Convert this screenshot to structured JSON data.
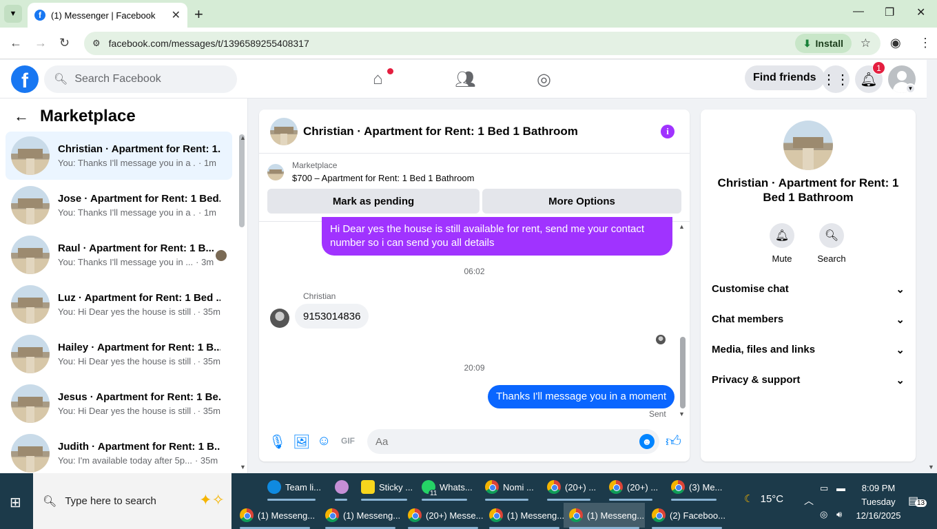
{
  "browser": {
    "tab_title": "(1) Messenger | Facebook",
    "url": "facebook.com/messages/t/1396589255408317",
    "install_label": "Install"
  },
  "fb": {
    "search_placeholder": "Search Facebook",
    "find_friends": "Find friends",
    "notifications_count": "1"
  },
  "left": {
    "title": "Marketplace",
    "conversations": [
      {
        "name": "Christian · Apartment for Rent: 1...",
        "msg": "You: Thanks I'll message you in a ...",
        "time": "· 1m"
      },
      {
        "name": "Jose · Apartment for Rent: 1 Bed...",
        "msg": "You: Thanks I'll message you in a ...",
        "time": "· 1m"
      },
      {
        "name": "Raul · Apartment for Rent: 1 B...",
        "msg": "You: Thanks I'll message you in ...",
        "time": "· 3m"
      },
      {
        "name": "Luz · Apartment for Rent: 1 Bed ...",
        "msg": "You: Hi Dear yes the house is still ...",
        "time": "· 35m"
      },
      {
        "name": "Hailey · Apartment for Rent: 1 B...",
        "msg": "You: Hi Dear yes the house is still ...",
        "time": "· 35m"
      },
      {
        "name": "Jesus · Apartment for Rent: 1 Be...",
        "msg": "You: Hi Dear yes the house is still ...",
        "time": "· 35m"
      },
      {
        "name": "Judith · Apartment for Rent: 1 B...",
        "msg": "You: I'm available today after 5p...",
        "time": "· 35m"
      }
    ]
  },
  "chat": {
    "title": "Christian · Apartment for Rent: 1 Bed 1 Bathroom",
    "listing_category": "Marketplace",
    "listing_title": "$700 – Apartment for Rent: 1 Bed 1 Bathroom",
    "mark_pending": "Mark as pending",
    "more_options": "More Options",
    "msg1": "Hi Dear yes the house is still available for rent, send me your contact number so i can send you all details",
    "time1": "06:02",
    "sender": "Christian",
    "msg2": "9153014836",
    "time2": "20:09",
    "msg3": "Thanks I'll message you in a moment",
    "sent_label": "Sent",
    "composer_placeholder": "Aa",
    "accent": "#a033ff"
  },
  "right": {
    "title": "Christian · Apartment for Rent: 1 Bed 1 Bathroom",
    "mute": "Mute",
    "search": "Search",
    "sections": [
      "Customise chat",
      "Chat members",
      "Media, files and links",
      "Privacy & support"
    ]
  },
  "taskbar": {
    "search_placeholder": "Type here to search",
    "row1": [
      {
        "label": "Team li..."
      },
      {
        "label": ""
      },
      {
        "label": "Sticky ..."
      },
      {
        "label": "Whats..."
      },
      {
        "label": "Nomi ..."
      },
      {
        "label": "(20+) ..."
      },
      {
        "label": "(20+) ..."
      },
      {
        "label": "(3) Me..."
      }
    ],
    "row2": [
      {
        "label": "(1) Messeng..."
      },
      {
        "label": "(1) Messeng..."
      },
      {
        "label": "(20+) Messe..."
      },
      {
        "label": "(1) Messeng..."
      },
      {
        "label": "(1) Messeng..."
      },
      {
        "label": "(2) Faceboo..."
      }
    ],
    "whatsapp_badge": "11",
    "weather": "15°C",
    "time": "8:09 PM",
    "day": "Tuesday",
    "date": "12/16/2025",
    "notif_count": "13"
  }
}
